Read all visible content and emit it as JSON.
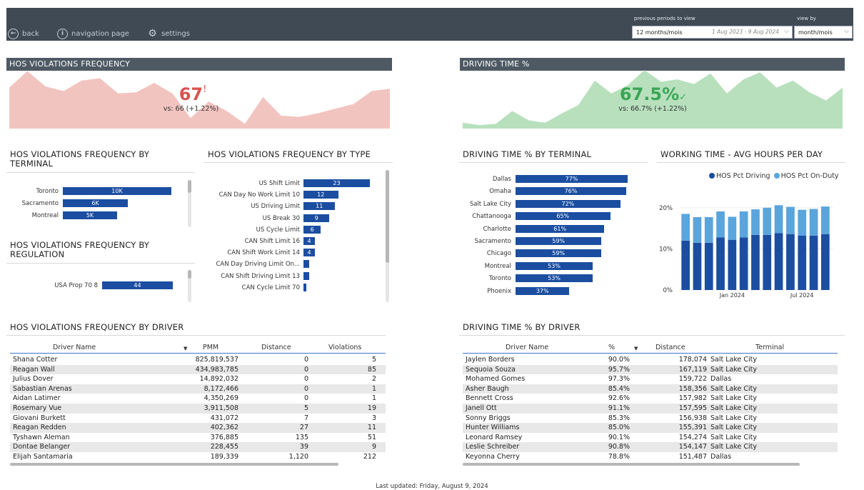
{
  "nav": {
    "back": "back",
    "navigation_page": "navigation page",
    "settings": "settings"
  },
  "filters": {
    "periods_label": "previous periods to view",
    "periods_value": "12 months/mois",
    "date_range": "1 Aug 2023 - 9 Aug 2024",
    "view_label": "view by",
    "view_value": "month/mois"
  },
  "kpi_hos": {
    "title": "HOS VIOLATIONS FREQUENCY",
    "value": "67",
    "indicator": "!",
    "vs": "vs: 66 (+1.22%)",
    "color": "#d9534f",
    "area_color": "#f2c4bf",
    "trend": [
      70,
      98,
      72,
      64,
      82,
      86,
      60,
      62,
      78,
      60,
      18,
      46,
      30,
      8,
      54,
      22,
      20,
      26,
      34,
      42,
      64,
      68
    ]
  },
  "kpi_driving": {
    "title": "DRIVING TIME %",
    "value": "67.5%",
    "indicator": "✓",
    "vs": "vs: 66.7% (+1.22%)",
    "color": "#3aa655",
    "area_color": "#b8e0bd",
    "trend": [
      10,
      6,
      8,
      30,
      14,
      10,
      26,
      40,
      82,
      60,
      74,
      100,
      80,
      84,
      76,
      94,
      60,
      84,
      96,
      70,
      82,
      62,
      48,
      70
    ]
  },
  "hos_by_terminal": {
    "title": "HOS VIOLATIONS FREQUENCY BY TERMINAL",
    "max": 10,
    "items": [
      {
        "label": "Toronto",
        "value": 10,
        "display": "10K"
      },
      {
        "label": "Sacramento",
        "value": 6,
        "display": "6K"
      },
      {
        "label": "Montreal",
        "value": 5,
        "display": "5K"
      }
    ]
  },
  "hos_by_regulation": {
    "title": "HOS VIOLATIONS FREQUENCY BY REGULATION",
    "max": 44,
    "items": [
      {
        "label": "USA Prop 70 8",
        "value": 44,
        "display": "44"
      }
    ]
  },
  "hos_by_type": {
    "title": "HOS VIOLATIONS FREQUENCY BY TYPE",
    "max": 23,
    "items": [
      {
        "label": "US Shift Limit",
        "value": 23,
        "display": "23"
      },
      {
        "label": "CAN Day No Work Limit 10",
        "value": 12,
        "display": "12"
      },
      {
        "label": "US Driving Limit",
        "value": 11,
        "display": "11"
      },
      {
        "label": "US Break 30",
        "value": 9,
        "display": "9"
      },
      {
        "label": "US Cycle Limit",
        "value": 6,
        "display": "6"
      },
      {
        "label": "CAN Shift Limit 16",
        "value": 4,
        "display": "4"
      },
      {
        "label": "CAN Shift Work Limit 14",
        "value": 4,
        "display": "4"
      },
      {
        "label": "CAN Day Driving Limit On...",
        "value": 2,
        "display": ""
      },
      {
        "label": "CAN Shift Driving Limit 13",
        "value": 2,
        "display": ""
      },
      {
        "label": "CAN Cycle Limit 70",
        "value": 1,
        "display": ""
      }
    ]
  },
  "driving_by_terminal": {
    "title": "DRIVING TIME % BY TERMINAL",
    "max": 77,
    "items": [
      {
        "label": "Dallas",
        "value": 77,
        "display": "77%"
      },
      {
        "label": "Omaha",
        "value": 76,
        "display": "76%"
      },
      {
        "label": "Salt Lake City",
        "value": 72,
        "display": "72%"
      },
      {
        "label": "Chattanooga",
        "value": 65,
        "display": "65%"
      },
      {
        "label": "Charlotte",
        "value": 61,
        "display": "61%"
      },
      {
        "label": "Sacramento",
        "value": 59,
        "display": "59%"
      },
      {
        "label": "Chicago",
        "value": 59,
        "display": "59%"
      },
      {
        "label": "Montreal",
        "value": 53,
        "display": "53%"
      },
      {
        "label": "Toronto",
        "value": 53,
        "display": "53%"
      },
      {
        "label": "Phoenix",
        "value": 37,
        "display": "37%"
      }
    ]
  },
  "chart_data": {
    "type": "bar",
    "title": "WORKING TIME - AVG HOURS PER DAY",
    "stacked": true,
    "legend_position": "top-right",
    "ylim": [
      0,
      25
    ],
    "yticks": [
      {
        "v": 0,
        "label": "0%"
      },
      {
        "v": 10,
        "label": "10%"
      },
      {
        "v": 20,
        "label": "20%"
      }
    ],
    "xtick_labels": [
      {
        "index": 4,
        "label": "Jan 2024"
      },
      {
        "index": 10,
        "label": "Jul 2024"
      }
    ],
    "categories": [
      "1",
      "2",
      "3",
      "4",
      "5",
      "6",
      "7",
      "8",
      "9",
      "10",
      "11",
      "12",
      "13"
    ],
    "series": [
      {
        "name": "HOS Pct Driving",
        "color": "#1b4ea1",
        "values": [
          12,
          11.5,
          11.5,
          12.8,
          12.2,
          12.8,
          13.4,
          13.4,
          13.8,
          13.6,
          13.2,
          13.2,
          13.6
        ]
      },
      {
        "name": "HOS Pct On-Duty",
        "color": "#5aa5dc",
        "values": [
          6.5,
          6.2,
          6.2,
          6.3,
          5.6,
          6.3,
          6.2,
          6.6,
          6.8,
          6.6,
          6.3,
          6.5,
          6.7
        ]
      }
    ]
  },
  "hos_by_driver": {
    "title": "HOS VIOLATIONS FREQUENCY BY DRIVER",
    "columns": [
      "Driver Name",
      "PMM",
      "Distance",
      "Violations"
    ],
    "rows": [
      [
        "Shana Cotter",
        "825,819,537",
        "0",
        "5"
      ],
      [
        "Reagan Wall",
        "434,983,785",
        "0",
        "85"
      ],
      [
        "Julius Dover",
        "14,892,032",
        "0",
        "2"
      ],
      [
        "Sabastian Arenas",
        "8,172,466",
        "0",
        "1"
      ],
      [
        "Aidan Latimer",
        "4,350,269",
        "0",
        "1"
      ],
      [
        "Rosemary Vue",
        "3,911,508",
        "5",
        "19"
      ],
      [
        "Giovani Burkett",
        "431,072",
        "7",
        "3"
      ],
      [
        "Reagan Redden",
        "402,362",
        "27",
        "11"
      ],
      [
        "Tyshawn Aleman",
        "376,885",
        "135",
        "51"
      ],
      [
        "Dontae Belanger",
        "228,455",
        "39",
        "9"
      ],
      [
        "Elijah Santamaria",
        "189,339",
        "1,120",
        "212"
      ]
    ]
  },
  "driving_by_driver": {
    "title": "DRIVING TIME % BY DRIVER",
    "columns": [
      "Driver Name",
      "%",
      "Distance",
      "Terminal"
    ],
    "rows": [
      [
        "Jaylen Borders",
        "90.0%",
        "178,074",
        "Salt Lake City"
      ],
      [
        "Sequoia Souza",
        "95.7%",
        "167,119",
        "Salt Lake City"
      ],
      [
        "Mohamed Gomes",
        "97.3%",
        "159,722",
        "Dallas"
      ],
      [
        "Asher Baugh",
        "85.4%",
        "158,356",
        "Salt Lake City"
      ],
      [
        "Bennett Cross",
        "92.6%",
        "157,982",
        "Salt Lake City"
      ],
      [
        "Janell Ott",
        "91.1%",
        "157,595",
        "Salt Lake City"
      ],
      [
        "Sonny Briggs",
        "85.3%",
        "156,938",
        "Salt Lake City"
      ],
      [
        "Hunter Williams",
        "85.0%",
        "155,391",
        "Salt Lake City"
      ],
      [
        "Leonard Ramsey",
        "90.1%",
        "154,274",
        "Salt Lake City"
      ],
      [
        "Leslie Schreiber",
        "90.8%",
        "154,147",
        "Salt Lake City"
      ],
      [
        "Keyonna Cherry",
        "78.8%",
        "151,487",
        "Dallas"
      ]
    ]
  },
  "footer": "Last updated: Friday, August 9, 2024"
}
